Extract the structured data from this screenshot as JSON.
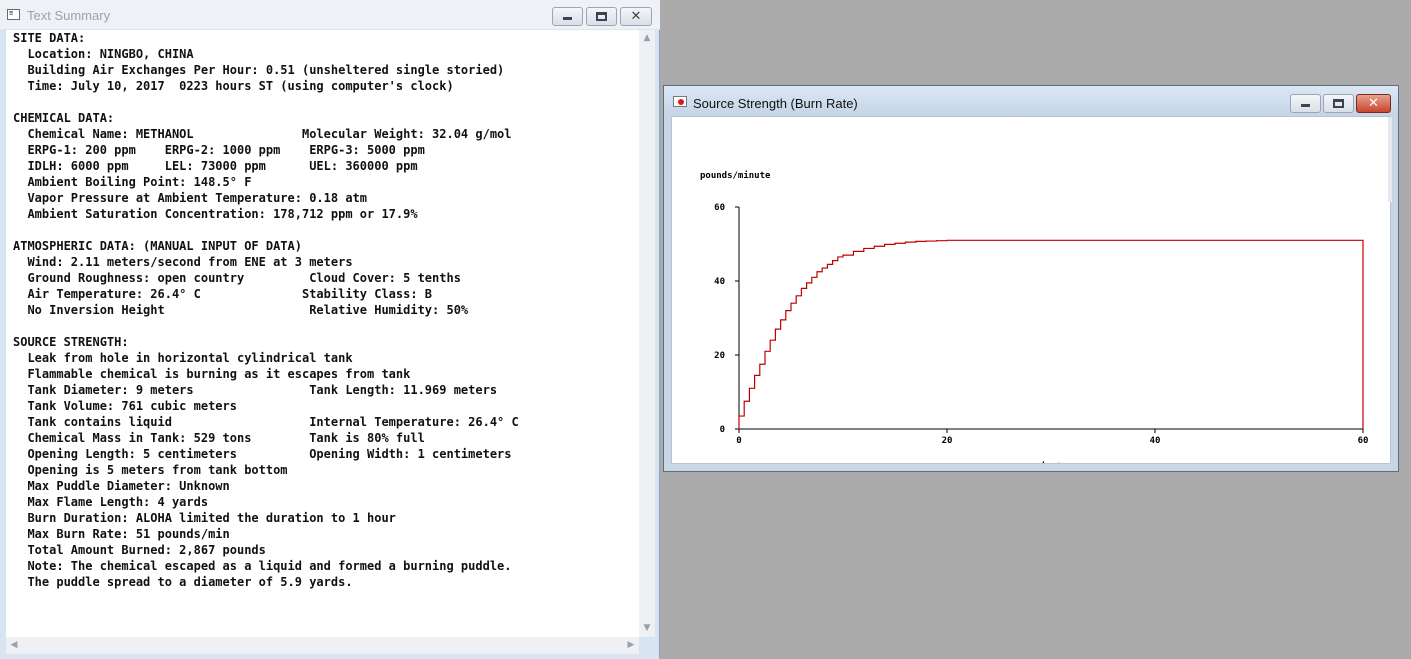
{
  "text_window": {
    "title": "Text Summary",
    "icon": "text-document-icon",
    "lines": [
      "SITE DATA:",
      "  Location: NINGBO, CHINA",
      "  Building Air Exchanges Per Hour: 0.51 (unsheltered single storied)",
      "  Time: July 10, 2017  0223 hours ST (using computer's clock)",
      "",
      "CHEMICAL DATA:",
      "  Chemical Name: METHANOL               Molecular Weight: 32.04 g/mol",
      "  ERPG-1: 200 ppm    ERPG-2: 1000 ppm    ERPG-3: 5000 ppm",
      "  IDLH: 6000 ppm     LEL: 73000 ppm      UEL: 360000 ppm",
      "  Ambient Boiling Point: 148.5° F",
      "  Vapor Pressure at Ambient Temperature: 0.18 atm",
      "  Ambient Saturation Concentration: 178,712 ppm or 17.9%",
      "",
      "ATMOSPHERIC DATA: (MANUAL INPUT OF DATA)",
      "  Wind: 2.11 meters/second from ENE at 3 meters",
      "  Ground Roughness: open country         Cloud Cover: 5 tenths",
      "  Air Temperature: 26.4° C              Stability Class: B",
      "  No Inversion Height                    Relative Humidity: 50%",
      "",
      "SOURCE STRENGTH:",
      "  Leak from hole in horizontal cylindrical tank",
      "  Flammable chemical is burning as it escapes from tank",
      "  Tank Diameter: 9 meters                Tank Length: 11.969 meters",
      "  Tank Volume: 761 cubic meters",
      "  Tank contains liquid                   Internal Temperature: 26.4° C",
      "  Chemical Mass in Tank: 529 tons        Tank is 80% full",
      "  Opening Length: 5 centimeters          Opening Width: 1 centimeters",
      "  Opening is 5 meters from tank bottom",
      "  Max Puddle Diameter: Unknown",
      "  Max Flame Length: 4 yards",
      "  Burn Duration: ALOHA limited the duration to 1 hour",
      "  Max Burn Rate: 51 pounds/min",
      "  Total Amount Burned: 2,867 pounds",
      "  Note: The chemical escaped as a liquid and formed a burning puddle.",
      "  The puddle spread to a diameter of 5.9 yards."
    ]
  },
  "graph_window": {
    "title": "Source Strength (Burn Rate)",
    "icon": "burn-rate-icon"
  },
  "window_controls": {
    "minimize": "minimize-icon",
    "maximize": "maximize-icon",
    "close_glyph": "✕"
  },
  "colors": {
    "series": "#c00000",
    "axis": "#000000"
  },
  "chart_data": {
    "type": "line",
    "step": true,
    "title": "",
    "xlabel": "minutes",
    "ylabel": "pounds/minute",
    "xlim": [
      0,
      60
    ],
    "ylim": [
      0,
      60
    ],
    "xticks": [
      0,
      20,
      40,
      60
    ],
    "yticks": [
      0,
      20,
      40,
      60
    ],
    "grid": false,
    "series": [
      {
        "x": [
          0,
          0.5,
          1,
          1.5,
          2,
          2.5,
          3,
          3.5,
          4,
          4.5,
          5,
          5.5,
          6,
          6.5,
          7,
          7.5,
          8,
          8.5,
          9,
          9.5,
          10,
          11,
          12,
          13,
          14,
          15,
          16,
          17,
          18,
          19,
          20,
          21,
          25,
          30,
          35,
          40,
          45,
          50,
          55,
          60
        ],
        "y": [
          3.5,
          7.5,
          11,
          14.5,
          17.5,
          21,
          24,
          27,
          29.5,
          32,
          34,
          36,
          38,
          39.5,
          41,
          42.5,
          43.5,
          44.5,
          45.5,
          46.5,
          47,
          48,
          48.8,
          49.4,
          49.9,
          50.2,
          50.5,
          50.7,
          50.8,
          50.9,
          51,
          51,
          51,
          51,
          51,
          51,
          51,
          51,
          51,
          0
        ]
      }
    ]
  }
}
